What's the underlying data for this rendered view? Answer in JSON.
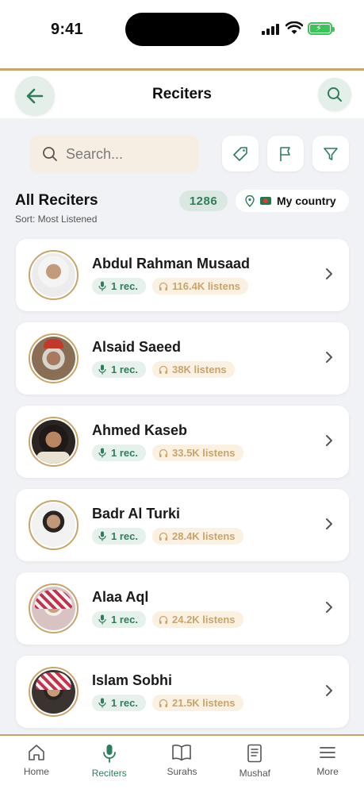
{
  "status_bar": {
    "time": "9:41"
  },
  "header": {
    "title": "Reciters"
  },
  "search": {
    "placeholder": "Search..."
  },
  "section": {
    "title": "All Reciters",
    "sort_label": "Sort: Most Listened",
    "count": "1286",
    "country_filter": "My country"
  },
  "reciters": [
    {
      "name": "Abdul Rahman Musaad",
      "recordings": "1 rec.",
      "listens": "116.4K listens"
    },
    {
      "name": "Alsaid Saeed",
      "recordings": "1 rec.",
      "listens": "38K listens"
    },
    {
      "name": "Ahmed Kaseb",
      "recordings": "1 rec.",
      "listens": "33.5K listens"
    },
    {
      "name": "Badr Al Turki",
      "recordings": "1 rec.",
      "listens": "28.4K listens"
    },
    {
      "name": "Alaa Aql",
      "recordings": "1 rec.",
      "listens": "24.2K listens"
    },
    {
      "name": "Islam Sobhi",
      "recordings": "1 rec.",
      "listens": "21.5K listens"
    }
  ],
  "nav": [
    {
      "label": "Home",
      "icon": "home-icon"
    },
    {
      "label": "Reciters",
      "icon": "microphone-icon"
    },
    {
      "label": "Surahs",
      "icon": "book-icon"
    },
    {
      "label": "Mushaf",
      "icon": "document-icon"
    },
    {
      "label": "More",
      "icon": "menu-icon"
    }
  ],
  "colors": {
    "accent": "#2f7d5b",
    "gold": "#c9a46c",
    "background": "#f1f2f5",
    "active_nav": "#2f7d5b"
  }
}
